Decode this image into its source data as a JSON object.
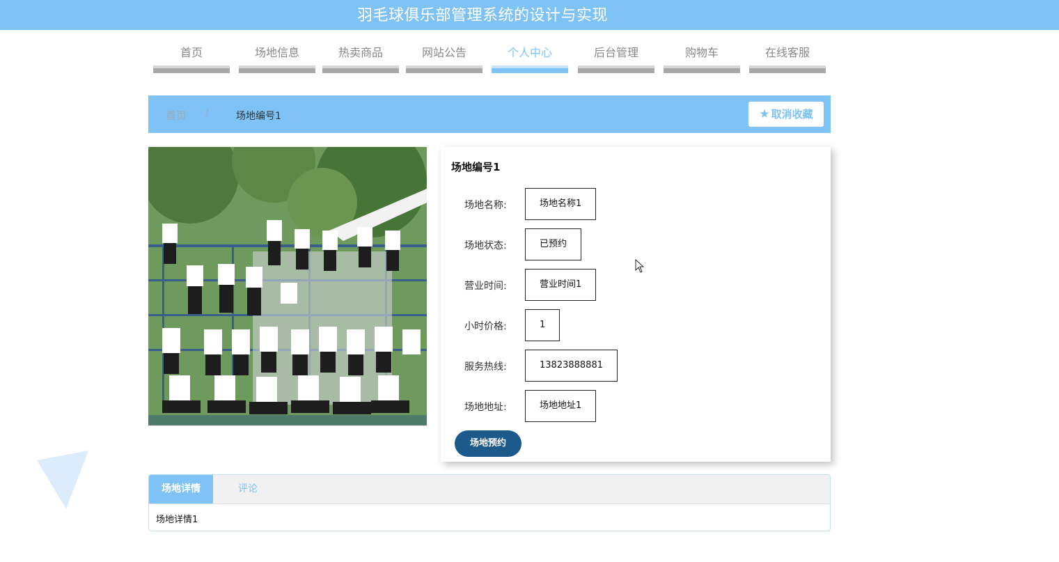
{
  "header": {
    "site_title": "羽毛球俱乐部管理系统的设计与实现"
  },
  "nav": {
    "items": [
      {
        "label": "首页"
      },
      {
        "label": "场地信息"
      },
      {
        "label": "热卖商品"
      },
      {
        "label": "网站公告"
      },
      {
        "label": "个人中心",
        "active": true
      },
      {
        "label": "后台管理"
      },
      {
        "label": "购物车"
      },
      {
        "label": "在线客服"
      }
    ]
  },
  "breadcrumb": {
    "home": "首页",
    "separator": "/",
    "current": "场地编号1"
  },
  "actions": {
    "favorite_label": "取消收藏",
    "favorite_icon": "star-icon"
  },
  "venue": {
    "title": "场地编号1",
    "fields": [
      {
        "label": "场地名称:",
        "value": "场地名称1"
      },
      {
        "label": "场地状态:",
        "value": "已预约"
      },
      {
        "label": "营业时间:",
        "value": "营业时间1"
      },
      {
        "label": "小时价格:",
        "value": "1"
      },
      {
        "label": "服务热线:",
        "value": "13823888881"
      },
      {
        "label": "场地地址:",
        "value": "场地地址1"
      }
    ],
    "book_label": "场地预约"
  },
  "tabs": {
    "items": [
      {
        "label": "场地详情",
        "active": true
      },
      {
        "label": "评论"
      }
    ],
    "content": "场地详情1"
  },
  "colors": {
    "accent": "#7fc3f6",
    "button_dark": "#1d5a8c",
    "nav_inactive": "#a7a7a7"
  }
}
